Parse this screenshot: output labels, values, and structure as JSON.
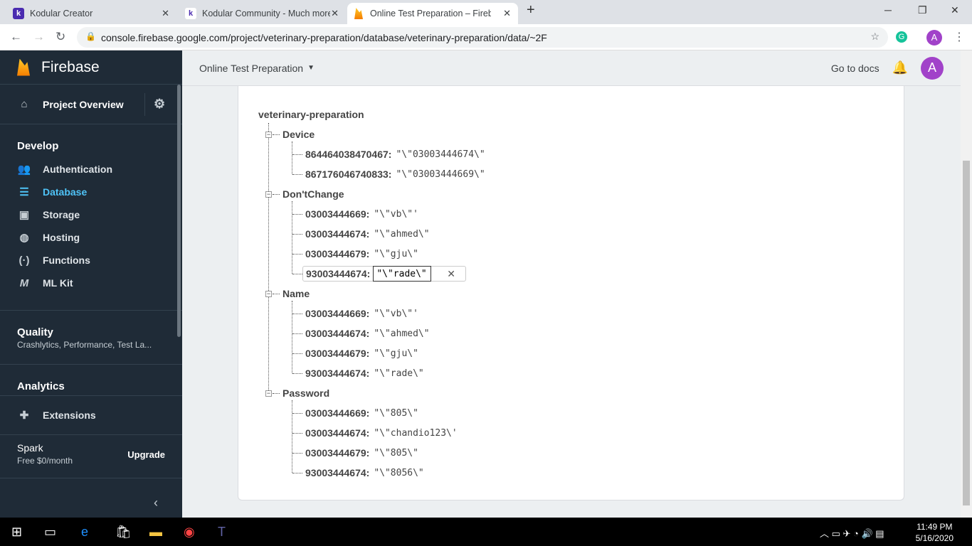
{
  "browser": {
    "tabs": [
      {
        "title": "Kodular Creator",
        "icon": "k"
      },
      {
        "title": "Kodular Community - Much more",
        "icon": "k"
      },
      {
        "title": "Online Test Preparation – Firebase",
        "icon": "flame"
      }
    ],
    "url": "console.firebase.google.com/project/veterinary-preparation/database/veterinary-preparation/data/~2F",
    "profile": "A"
  },
  "sidebar": {
    "brand": "Firebase",
    "project_overview": "Project Overview",
    "develop": "Develop",
    "develop_items": [
      "Authentication",
      "Database",
      "Storage",
      "Hosting",
      "Functions",
      "ML Kit"
    ],
    "quality": "Quality",
    "quality_sub": "Crashlytics, Performance, Test La...",
    "analytics": "Analytics",
    "extensions": "Extensions",
    "plan": "Spark",
    "plan_price": "Free $0/month",
    "upgrade": "Upgrade"
  },
  "topbar": {
    "project": "Online Test Preparation",
    "docs": "Go to docs",
    "avatar": "A"
  },
  "tree": {
    "root": "veterinary-preparation",
    "nodes": [
      {
        "name": "Device",
        "children": [
          {
            "k": "864464038470467:",
            "v": "\"\\\"03003444674\\\""
          },
          {
            "k": "867176046740833:",
            "v": "\"\\\"03003444669\\\""
          }
        ]
      },
      {
        "name": "Don'tChange",
        "children": [
          {
            "k": "03003444669:",
            "v": "\"\\\"vb\\\"'"
          },
          {
            "k": "03003444674:",
            "v": "\"\\\"ahmed\\\""
          },
          {
            "k": "03003444679:",
            "v": "\"\\\"gju\\\""
          },
          {
            "k": "93003444674:",
            "v": "\"\\\"rade\\\""
          }
        ]
      },
      {
        "name": "Name",
        "children": [
          {
            "k": "03003444669:",
            "v": "\"\\\"vb\\\"'"
          },
          {
            "k": "03003444674:",
            "v": "\"\\\"ahmed\\\""
          },
          {
            "k": "03003444679:",
            "v": "\"\\\"gju\\\""
          },
          {
            "k": "93003444674:",
            "v": "\"\\\"rade\\\""
          }
        ]
      },
      {
        "name": "Password",
        "children": [
          {
            "k": "03003444669:",
            "v": "\"\\\"805\\\""
          },
          {
            "k": "03003444674:",
            "v": "\"\\\"chandio123\\'"
          },
          {
            "k": "03003444679:",
            "v": "\"\\\"805\\\""
          },
          {
            "k": "93003444674:",
            "v": "\"\\\"8056\\\""
          }
        ]
      }
    ]
  },
  "taskbar": {
    "time": "11:49 PM",
    "date": "5/16/2020"
  }
}
